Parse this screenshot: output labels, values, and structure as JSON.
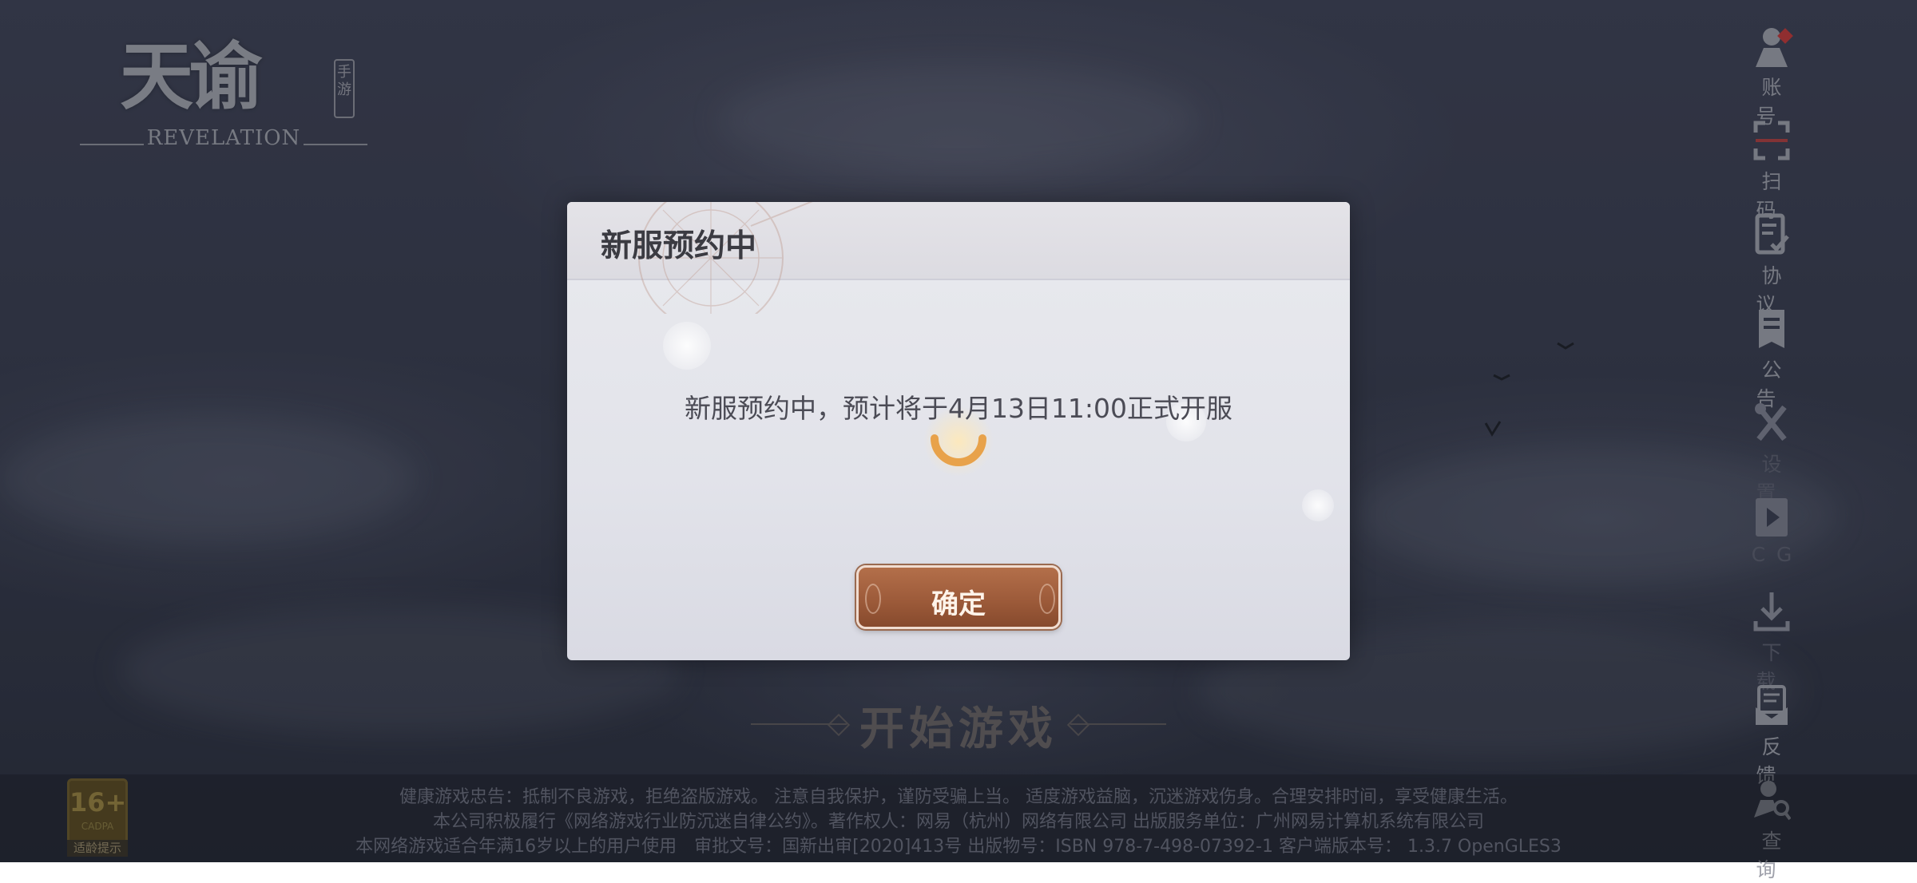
{
  "game": {
    "logo_text": "天谕",
    "logo_tag": "手游",
    "logo_sub": "REVELATION"
  },
  "sidebar": {
    "items": [
      {
        "label": "账号",
        "icon": "account-icon"
      },
      {
        "label": "扫码",
        "icon": "scan-icon"
      },
      {
        "label": "协议",
        "icon": "agreement-icon"
      },
      {
        "label": "公告",
        "icon": "announcement-icon"
      },
      {
        "label": "设置",
        "icon": "settings-icon"
      },
      {
        "label": "CG",
        "icon": "cg-video-icon"
      },
      {
        "label": "下载",
        "icon": "download-icon"
      },
      {
        "label": "反馈",
        "icon": "feedback-icon"
      },
      {
        "label": "查询",
        "icon": "query-icon"
      }
    ]
  },
  "start_button": {
    "label": "开始游戏"
  },
  "modal": {
    "title": "新服预约中",
    "message": "新服预约中，预计将于4月13日11:00正式开服",
    "confirm_label": "确定"
  },
  "age_badge": {
    "rating": "16+",
    "small": "CADPA",
    "caption": "适龄提示"
  },
  "footer": {
    "line1": "健康游戏忠告：抵制不良游戏，拒绝盗版游戏。 注意自我保护，谨防受骗上当。 适度游戏益脑，沉迷游戏伤身。合理安排时间，享受健康生活。",
    "line2": "本公司积极履行《网络游戏行业防沉迷自律公约》。著作权人：网易（杭州）网络有限公司 出版服务单位：广州网易计算机系统有限公司",
    "line3": "本网络游戏适合年满16岁以上的用户使用　审批文号：国新出审[2020]413号 出版物号：ISBN 978-7-498-07392-1  客户端版本号： 1.3.7 OpenGLES3"
  },
  "colors": {
    "button_brown": "#9d5b3a",
    "modal_bg": "#e2e3ea",
    "alert_red": "#c23a3a"
  }
}
